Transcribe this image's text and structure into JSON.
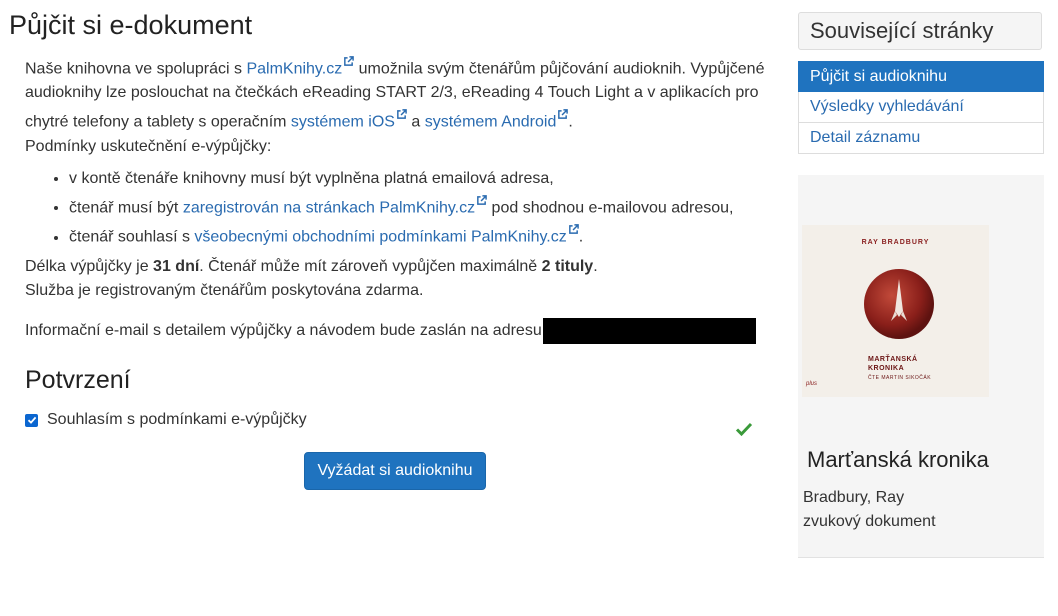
{
  "main": {
    "title": "Půjčit si e-dokument",
    "intro": {
      "t1": "Naše knihovna ve spolupráci s ",
      "link_palmknihy": "PalmKnihy.cz",
      "t2": " umožnila svým čtenářům půjčování audioknih. Vypůjčené audioknihy lze poslouchat na čtečkách eReading START 2/3, eReading 4 Touch Light a v aplikacích pro chytré telefony a tablety s operačním ",
      "link_ios": "systémem iOS",
      "t3": " a ",
      "link_android": "systémem Android",
      "t4": ".",
      "conditions": "Podmínky uskutečnění e-výpůjčky:"
    },
    "conditions_list": {
      "item1": "v kontě čtenáře knihovny musí být vyplněna platná emailová adresa,",
      "item2_pre": "čtenář musí být ",
      "item2_link": "zaregistrován na stránkach PalmKnihy.cz",
      "item2_post": " pod shodnou e-mailovou adresou,",
      "item3_pre": "čtenář souhlasí s ",
      "item3_link": "všeobecnými obchodními podmínkami PalmKnihy.cz",
      "item3_post": "."
    },
    "loan": {
      "t1": "Délka výpůjčky je ",
      "days": "31 dní",
      "t2": ". Čtenář může mít zároveň vypůjčen maximálně ",
      "titles": "2 tituly",
      "t3": ".",
      "free": "Služba je registrovaným čtenářům poskytována zdarma."
    },
    "email_info": "Informační e-mail s detailem výpůjčky a návodem bude zaslán na adresu",
    "confirm_heading": "Potvrzení",
    "agree_label": "Souhlasím s podmínkami e-výpůjčky",
    "agree_checked": true,
    "submit_label": "Vyžádat si audioknihu"
  },
  "sidebar": {
    "related_title": "Související stránky",
    "items": [
      {
        "label": "Půjčit si audioknihu",
        "active": true
      },
      {
        "label": "Výsledky vyhledávání",
        "active": false
      },
      {
        "label": "Detail záznamu",
        "active": false
      }
    ],
    "book": {
      "cover_author": "RAY BRADBURY",
      "cover_title_line1": "MARŤANSKÁ",
      "cover_title_line2": "KRONIKA",
      "cover_reader": "ČTE MARTIN SIKOČÁK",
      "cover_publisher": "plus",
      "title": "Marťanská kronika",
      "author": "Bradbury, Ray",
      "type": "zvukový dokument"
    }
  },
  "colors": {
    "link": "#2a6bb0",
    "primary": "#1f73bf",
    "success_check": "#3a9a3a"
  }
}
